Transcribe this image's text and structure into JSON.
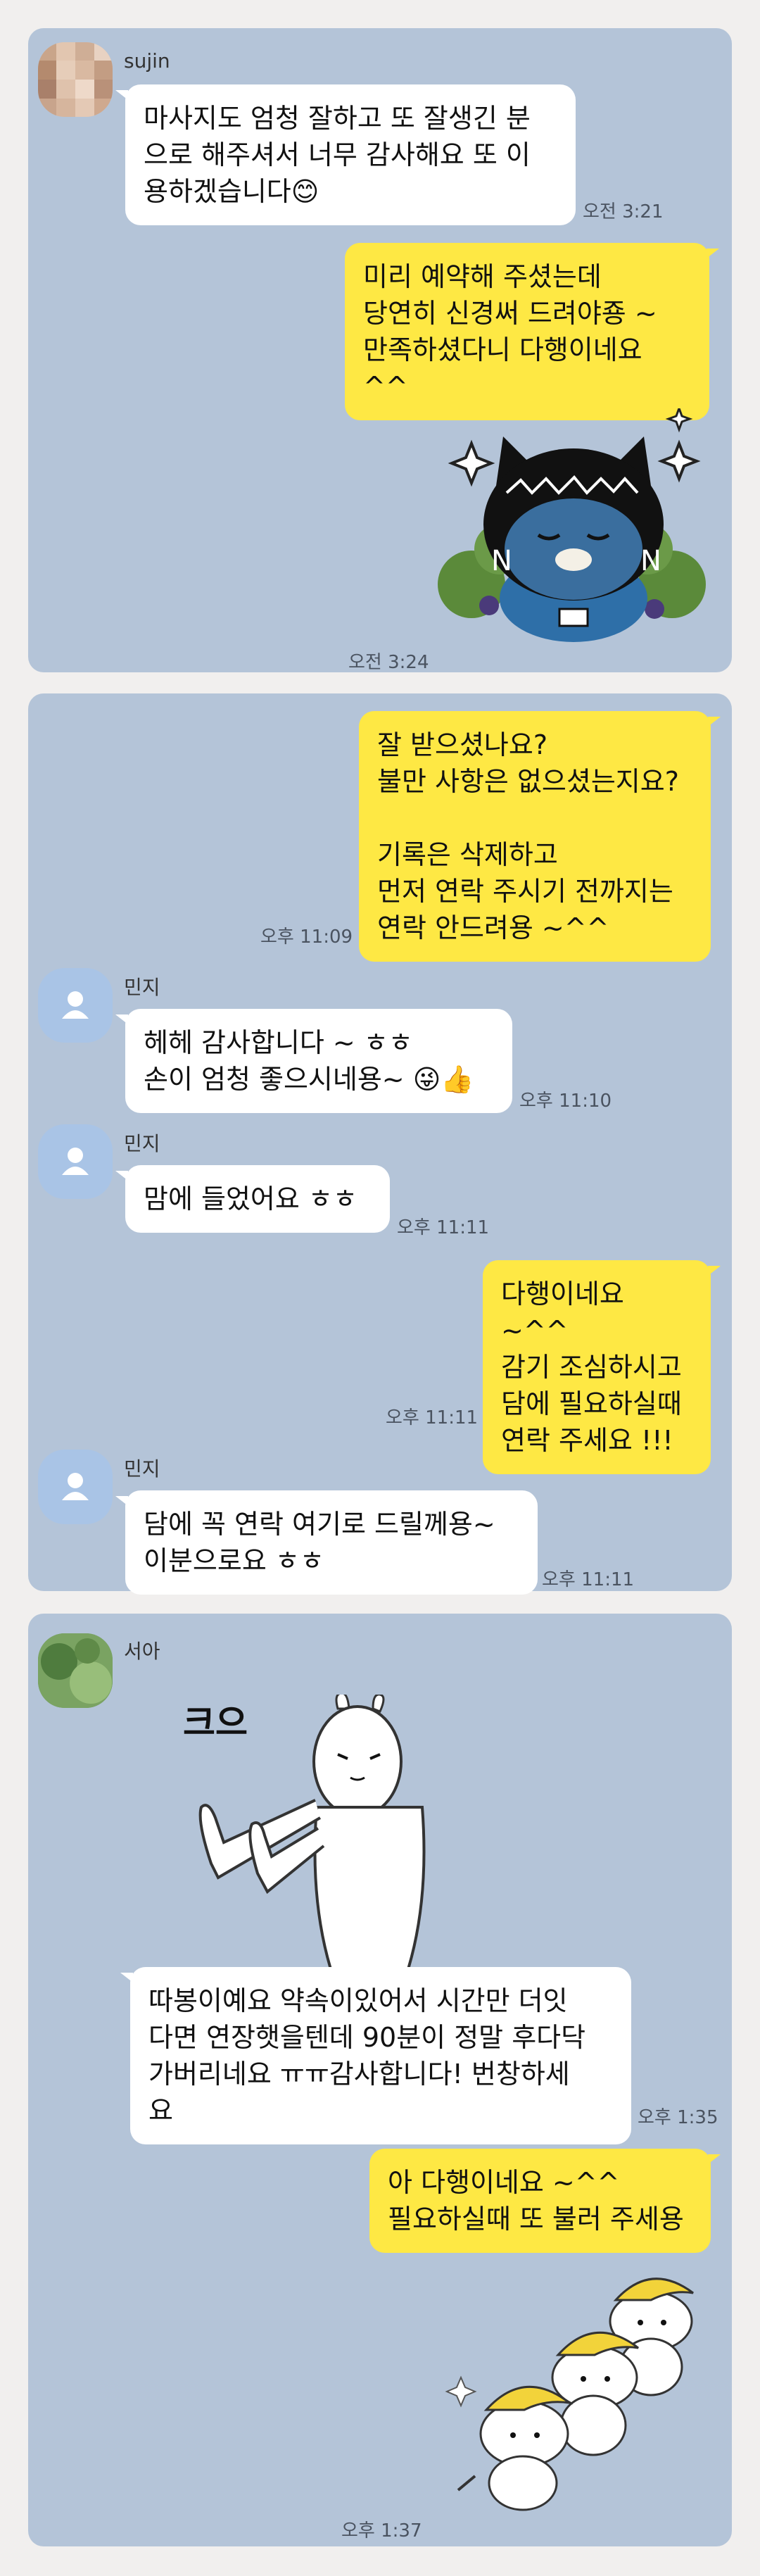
{
  "panels": [
    {
      "messages": [
        {
          "sender": "sujin",
          "text": "마사지도 엄청 잘하고 또 잘생긴 분\n으로 해주셔서 너무 감사해요 또 이\n용하겠습니다😊",
          "time": "오전 3:21"
        },
        {
          "text": "미리 예약해 주셨는데\n당연히 신경써 드려야죵 ~\n만족하셨다니 다행이네요 ^^"
        },
        {
          "sticker": "ryan-sticker",
          "time": "오전 3:24"
        }
      ]
    },
    {
      "messages": [
        {
          "text": "잘 받으셨나요?\n불만 사항은 없으셨는지요?\n\n기록은 삭제하고\n먼저 연락 주시기 전까지는\n연락 안드려용 ~^^",
          "time": "오후 11:09"
        },
        {
          "sender": "민지",
          "text": "헤헤 감사합니다 ~ ㅎㅎ\n손이 엄청 좋으시네용~ 😜👍",
          "time": "오후 11:10"
        },
        {
          "sender": "민지",
          "text": "맘에 들었어요 ㅎㅎ",
          "time": "오후 11:11"
        },
        {
          "text": "다행이네요 ~^^\n감기 조심하시고\n담에 필요하실때\n연락 주세요 !!!",
          "time": "오후 11:11"
        },
        {
          "sender": "민지",
          "text": "담에 꼭 연락 여기로 드릴께용~\n이분으로요 ㅎㅎ",
          "time": "오후 11:11"
        }
      ]
    },
    {
      "messages": [
        {
          "sender": "서아",
          "sticker": "thumbs-up-rabbit-sticker",
          "sticker_text": "크으"
        },
        {
          "text": "따봉이예요 약속이있어서 시간만 더잇\n다면 연장햇을텐데 90분이 정말 후다닥\n가버리네요 ㅠㅠ감사합니다! 번창하세\n요",
          "time": "오후 1:35"
        },
        {
          "text": "아 다행이네요 ~^^\n필요하실때 또 불러 주세용"
        },
        {
          "sticker": "banana-rabbits-sticker",
          "time": "오후 1:37"
        }
      ]
    }
  ],
  "colors": {
    "panel": "#b4c4d8",
    "bubble_in": "#ffffff",
    "bubble_out": "#fee844",
    "page": "#f1efee"
  }
}
